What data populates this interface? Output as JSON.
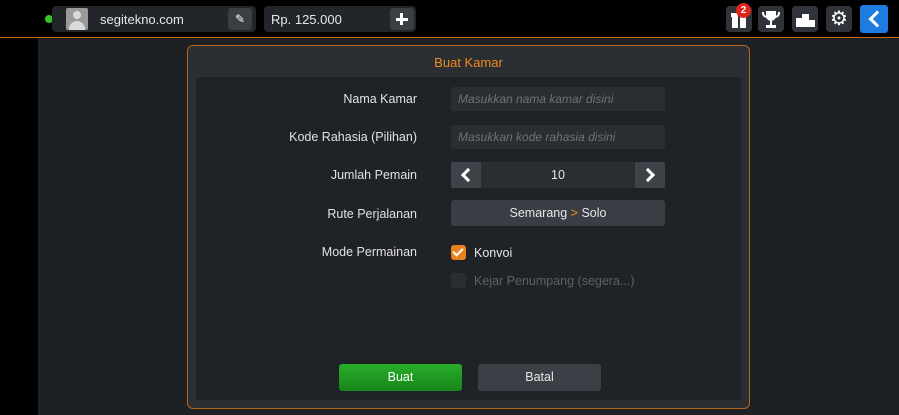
{
  "topbar": {
    "username": "segitekno.com",
    "money": "Rp. 125.000",
    "gift_badge": "2",
    "icons": [
      "gift-icon",
      "trophy-icon",
      "podium-icon",
      "gear-icon",
      "back-arrow-icon"
    ],
    "colors": {
      "online": "#39c12a",
      "accent": "#c86a12",
      "back": "#1e7be0",
      "badge": "#e1231b"
    }
  },
  "dialog": {
    "title": "Buat Kamar",
    "fields": {
      "room_name": {
        "label": "Nama Kamar",
        "placeholder": "Masukkan nama kamar disini",
        "value": ""
      },
      "secret_code": {
        "label": "Kode Rahasia (Pilihan)",
        "placeholder": "Masukkan kode rahasia disini",
        "value": ""
      },
      "players": {
        "label": "Jumlah Pemain",
        "value": "10"
      },
      "route": {
        "label": "Rute Perjalanan",
        "from": "Semarang",
        "separator": ">",
        "to": "Solo"
      },
      "mode": {
        "label": "Mode Permainan",
        "options": [
          {
            "label": "Konvoi",
            "checked": true,
            "enabled": true
          },
          {
            "label": "Kejar Penumpang (segera...)",
            "checked": false,
            "enabled": false
          }
        ]
      }
    },
    "buttons": {
      "create": "Buat",
      "cancel": "Batal"
    },
    "colors": {
      "title": "#f08a1e",
      "create": "#1f9a1f",
      "checkbox": "#e8821e"
    }
  }
}
